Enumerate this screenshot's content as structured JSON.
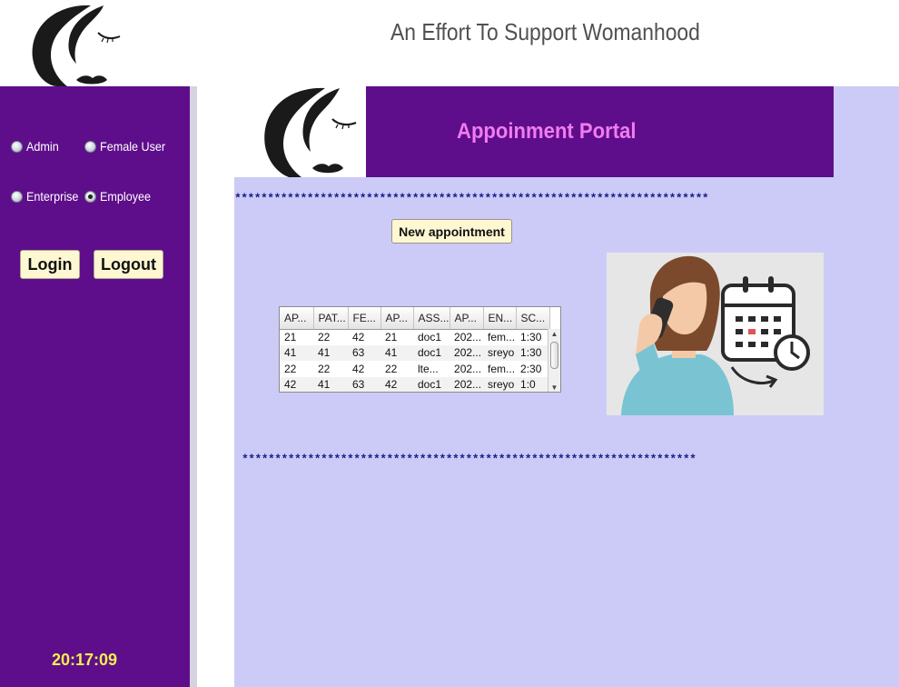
{
  "header": {
    "tagline": "An Effort To Support Womanhood"
  },
  "sidebar": {
    "roles": [
      {
        "label": "Admin",
        "checked": false
      },
      {
        "label": "Female User",
        "checked": false
      },
      {
        "label": "Enterprise",
        "checked": false
      },
      {
        "label": "Employee",
        "checked": true
      }
    ],
    "login_label": "Login",
    "logout_label": "Logout",
    "clock": "20:17:09"
  },
  "main": {
    "banner_title": "Appoinment Portal",
    "stars_top": "************************************************************************",
    "stars_bottom": "*********************************************************************",
    "new_appointment_label": "New appointment",
    "table": {
      "columns": [
        "AP...",
        "PAT...",
        "FE...",
        "AP...",
        "ASS...",
        "AP...",
        "EN...",
        "SC..."
      ],
      "rows": [
        [
          "21",
          "22",
          "42",
          "21",
          "doc1",
          "202...",
          "fem...",
          "1:30"
        ],
        [
          "41",
          "41",
          "63",
          "41",
          "doc1",
          "202...",
          "sreyo",
          "1:30"
        ],
        [
          "22",
          "22",
          "42",
          "22",
          "lte...",
          "202...",
          "fem...",
          "2:30"
        ],
        [
          "42",
          "41",
          "63",
          "42",
          "doc1",
          "202...",
          "sreyo",
          "1:0"
        ]
      ]
    }
  },
  "colors": {
    "sidebar": "#5e0e8b",
    "main_bg": "#cccbf7",
    "banner_title": "#f27bf0",
    "clock": "#f2f04a",
    "button_bg": "#fdf7d2"
  }
}
